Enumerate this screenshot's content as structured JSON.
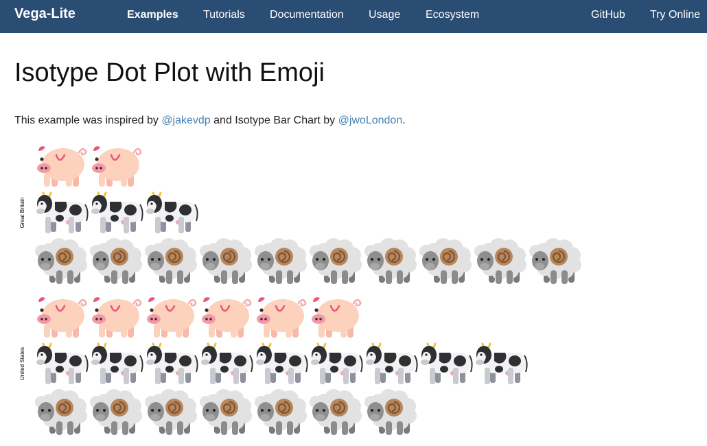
{
  "navbar": {
    "brand": "Vega-Lite",
    "links": [
      {
        "label": "Examples",
        "active": true
      },
      {
        "label": "Tutorials"
      },
      {
        "label": "Documentation"
      },
      {
        "label": "Usage"
      },
      {
        "label": "Ecosystem"
      }
    ],
    "right_links": [
      {
        "label": "GitHub"
      },
      {
        "label": "Try Online"
      }
    ]
  },
  "page": {
    "title": "Isotype Dot Plot with Emoji",
    "intro": {
      "prefix": "This example was inspired by ",
      "link1": "@jakevdp",
      "middle": " and Isotype Bar Chart by ",
      "link2": "@jwoLondon",
      "suffix": "."
    }
  },
  "colors": {
    "navbar": "#2a4d74",
    "link": "#4682b4"
  },
  "chart_data": {
    "type": "isotype",
    "icons": {
      "pigs": "pig-icon",
      "cattle": "cow-icon",
      "sheep": "sheep-icon"
    },
    "rows": [
      {
        "country": "Great Britain",
        "series": [
          {
            "animal": "pigs",
            "count": 2
          },
          {
            "animal": "cattle",
            "count": 3
          },
          {
            "animal": "sheep",
            "count": 10
          }
        ]
      },
      {
        "country": "United States",
        "series": [
          {
            "animal": "pigs",
            "count": 6
          },
          {
            "animal": "cattle",
            "count": 9
          },
          {
            "animal": "sheep",
            "count": 7
          }
        ]
      }
    ]
  }
}
